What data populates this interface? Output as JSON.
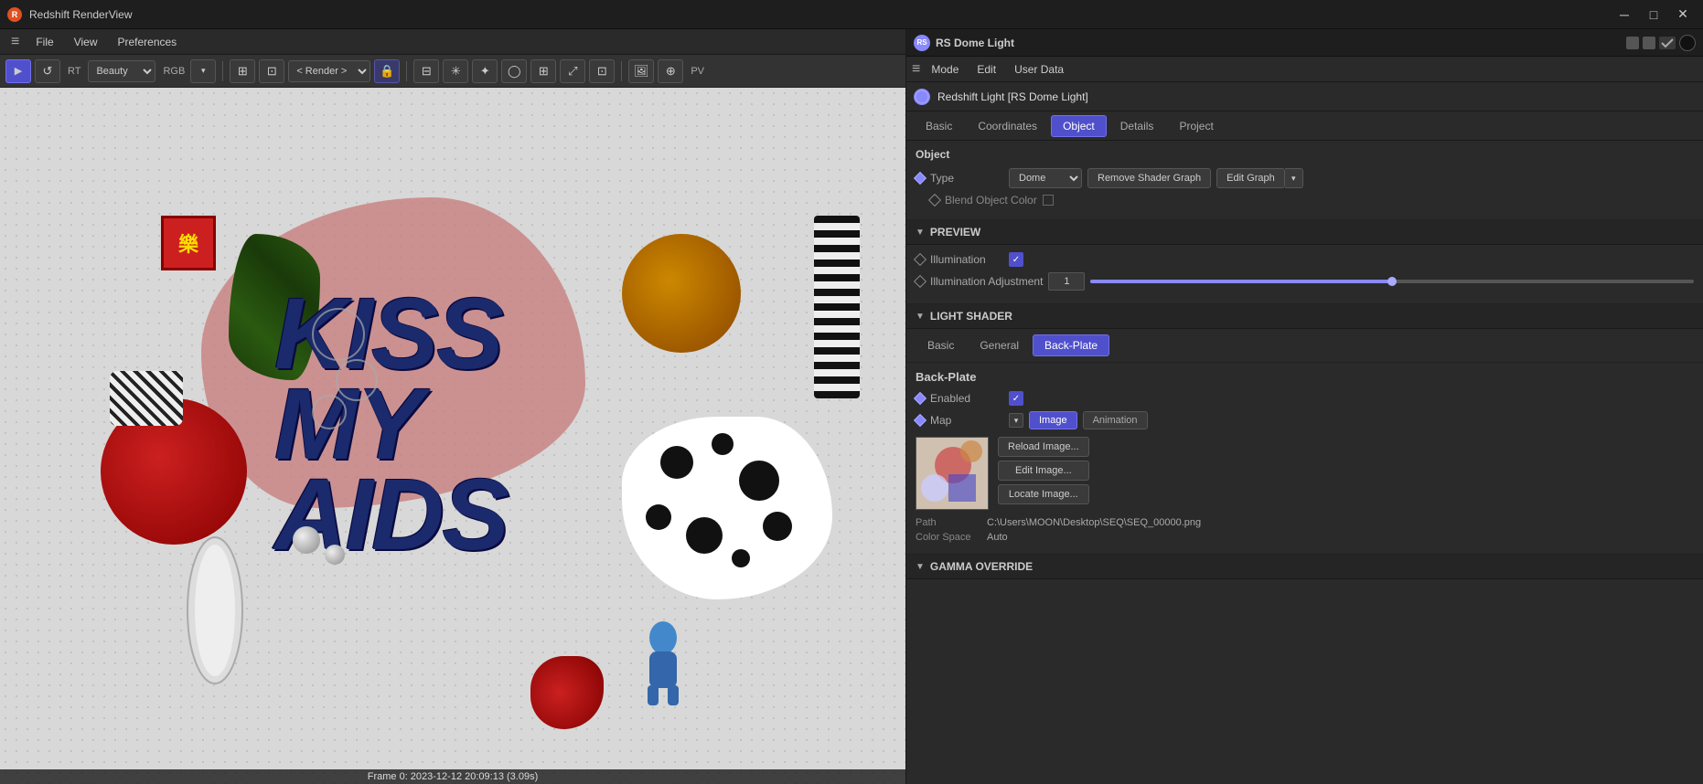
{
  "titlebar": {
    "icon_label": "R",
    "title": "Redshift RenderView",
    "min_btn": "─",
    "max_btn": "□",
    "close_btn": "✕"
  },
  "menubar": {
    "hamburger": "≡",
    "items": [
      "File",
      "View",
      "Preferences"
    ]
  },
  "toolbar": {
    "play_btn": "▶",
    "refresh_btn": "↺",
    "rt_label": "RT",
    "beauty_label": "Beauty",
    "rgb_label": "RGB",
    "render_label": "< Render >",
    "pv_label": "PV"
  },
  "viewport": {
    "jp_char": "樂",
    "kiss_text_line1": "KISS",
    "kiss_text_line2": "MY",
    "kiss_text_line3": "AIDS",
    "status": "Frame 0:  2023-12-12  20:09:13  (3.09s)"
  },
  "rs_header": {
    "icon_label": "RS",
    "title": "RS Dome Light"
  },
  "props": {
    "topbar": {
      "icon": "≡",
      "mode_label": "Mode",
      "edit_label": "Edit",
      "userdata_label": "User Data"
    },
    "light_name": "Redshift Light [RS Dome Light]",
    "tabs": [
      "Basic",
      "Coordinates",
      "Object",
      "Details",
      "Project"
    ],
    "active_tab": "Object",
    "object_section": {
      "title": "Object",
      "type_label": "Type",
      "type_value": "Dome",
      "remove_shader_btn": "Remove Shader Graph",
      "edit_graph_btn": "Edit Graph",
      "blend_label": "Blend Object Color"
    },
    "preview_section": {
      "title": "PREVIEW",
      "illumination_label": "Illumination",
      "illumination_adj_label": "Illumination Adjustment",
      "illumination_adj_value": "1",
      "slider_pct": 50
    },
    "light_shader": {
      "title": "LIGHT SHADER",
      "tabs": [
        "Basic",
        "General",
        "Back-Plate"
      ],
      "active_tab": "Back-Plate"
    },
    "backplate": {
      "title": "Back-Plate",
      "enabled_label": "Enabled",
      "map_label": "Map",
      "map_tabs": [
        "Image",
        "Animation"
      ],
      "active_map_tab": "Image",
      "reload_btn": "Reload Image...",
      "edit_btn": "Edit Image...",
      "locate_btn": "Locate Image...",
      "path_label": "Path",
      "path_value": "C:\\Users\\MOON\\Desktop\\SEQ\\SEQ_00000.png",
      "colorspace_label": "Color Space",
      "colorspace_value": "Auto"
    },
    "gamma_override": {
      "title": "GAMMA OVERRIDE"
    }
  }
}
